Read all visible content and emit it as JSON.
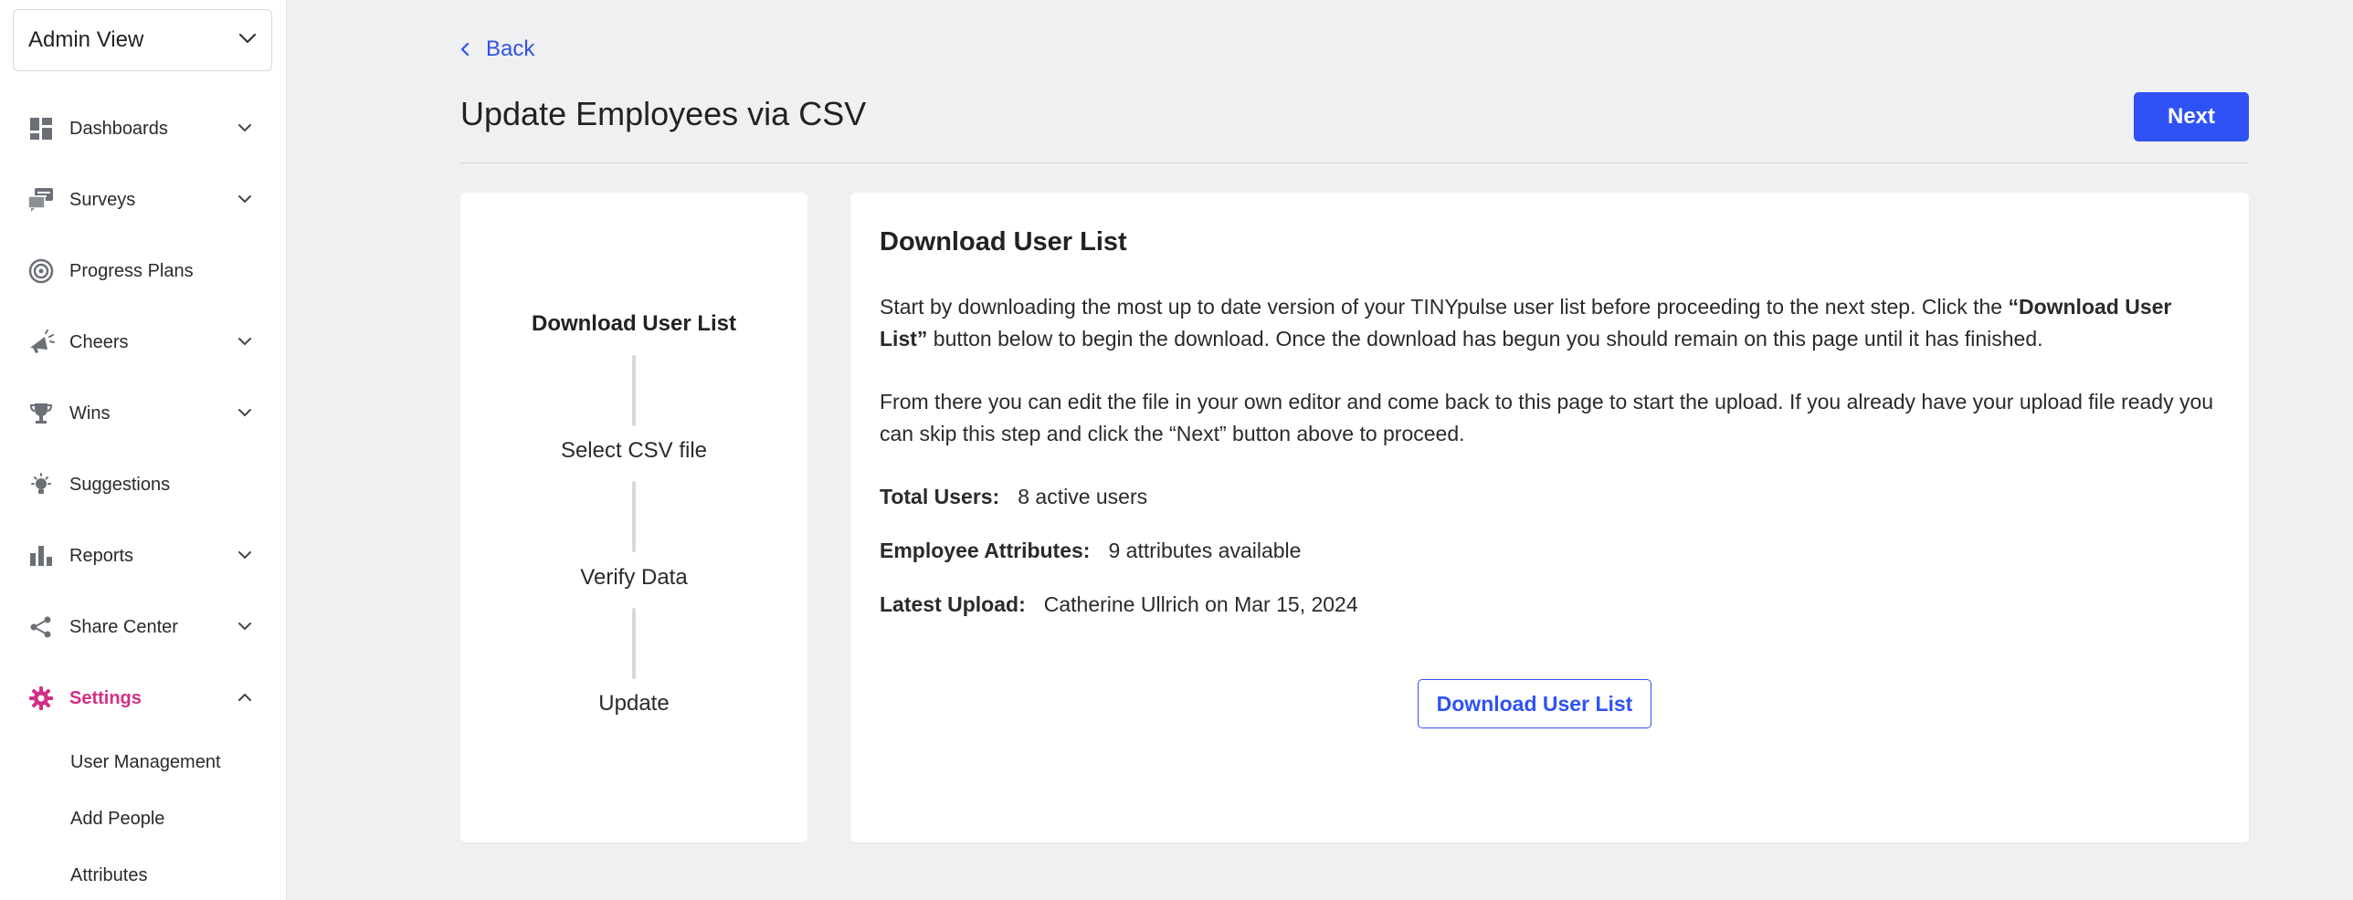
{
  "sidebar": {
    "view_select": {
      "label": "Admin View"
    },
    "items": [
      {
        "label": "Dashboards",
        "icon": "dashboard-icon",
        "expandable": true
      },
      {
        "label": "Surveys",
        "icon": "survey-icon",
        "expandable": true
      },
      {
        "label": "Progress Plans",
        "icon": "target-icon",
        "expandable": false
      },
      {
        "label": "Cheers",
        "icon": "megaphone-icon",
        "expandable": true
      },
      {
        "label": "Wins",
        "icon": "trophy-icon",
        "expandable": true
      },
      {
        "label": "Suggestions",
        "icon": "lightbulb-icon",
        "expandable": false
      },
      {
        "label": "Reports",
        "icon": "bar-chart-icon",
        "expandable": true
      },
      {
        "label": "Share Center",
        "icon": "share-icon",
        "expandable": true
      },
      {
        "label": "Settings",
        "icon": "gear-icon",
        "expandable": true,
        "active": true
      }
    ],
    "settings_sub": [
      "User Management",
      "Add People",
      "Attributes"
    ]
  },
  "header": {
    "back_label": "Back",
    "title": "Update Employees via CSV",
    "next_label": "Next"
  },
  "steps": [
    {
      "label": "Download User List",
      "active": true
    },
    {
      "label": "Select CSV file",
      "active": false
    },
    {
      "label": "Verify Data",
      "active": false
    },
    {
      "label": "Update",
      "active": false
    }
  ],
  "content": {
    "title": "Download User List",
    "para1_a": "Start by downloading the most up to date version of your TINYpulse user list before proceeding to the next step. Click the ",
    "para1_b": "“Download User List”",
    "para1_c": " button below to begin the download. Once the download has begun you should remain on this page until it has finished.",
    "para2": "From there you can edit the file in your own editor and come back to this page to start the upload. If you already have your upload file ready you can skip this step and click the “Next” button above to proceed.",
    "stats": [
      {
        "key": "Total Users:",
        "value": "8 active users"
      },
      {
        "key": "Employee Attributes:",
        "value": "9 attributes available"
      },
      {
        "key": "Latest Upload:",
        "value": "Catherine Ullrich on Mar 15, 2024"
      }
    ],
    "download_label": "Download User List"
  },
  "colors": {
    "accent": "#2f52f4",
    "active_nav": "#d42e86",
    "background": "#eff0f2"
  }
}
